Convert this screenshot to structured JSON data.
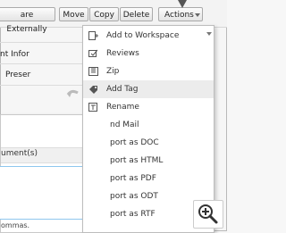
{
  "toolbar": {
    "share_label": "are Externally",
    "move_label": "Move",
    "copy_label": "Copy",
    "delete_label": "Delete",
    "actions_label": "Actions"
  },
  "list": {
    "rows": [
      {
        "label": "nt Infor"
      },
      {
        "label": "Preser"
      }
    ]
  },
  "menu": {
    "items": [
      {
        "label": "Add to Workspace",
        "icon": "add-to-workspace-icon"
      },
      {
        "label": "Reviews",
        "icon": "reviews-icon"
      },
      {
        "label": "Zip",
        "icon": "zip-icon"
      },
      {
        "label": "Add Tag",
        "icon": "tag-icon",
        "highlighted": true
      },
      {
        "label": "Rename",
        "icon": "rename-icon"
      },
      {
        "label": "nd Mail",
        "icon": ""
      },
      {
        "label": "port as DOC",
        "icon": ""
      },
      {
        "label": "port as HTML",
        "icon": ""
      },
      {
        "label": "port as PDF",
        "icon": ""
      },
      {
        "label": "port as ODT",
        "icon": ""
      },
      {
        "label": "port as RTF",
        "icon": ""
      }
    ]
  },
  "dialog": {
    "close_glyph": "×",
    "field_label": "ument(s)",
    "hint": "ommas."
  },
  "colors": {
    "highlight": "#ececec",
    "input_border": "#8fc7ee"
  }
}
